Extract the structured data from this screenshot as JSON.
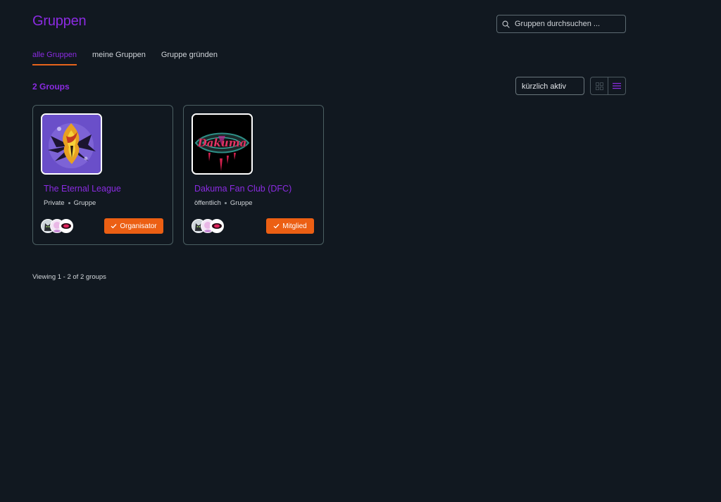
{
  "header": {
    "title": "Gruppen",
    "search_placeholder": "Gruppen durchsuchen ..."
  },
  "tabs": [
    {
      "label": "alle Gruppen",
      "active": true
    },
    {
      "label": "meine Gruppen",
      "active": false
    },
    {
      "label": "Gruppe gründen",
      "active": false
    }
  ],
  "toolbar": {
    "group_count": "2 Groups",
    "sort_selected": "kürzlich aktiv",
    "view_mode": "list"
  },
  "groups": [
    {
      "name": "The Eternal League",
      "privacy": "Private",
      "type": "Gruppe",
      "status_label": "Organisator",
      "avatar_icon": "flame-sun-emblem"
    },
    {
      "name": "Dakuma Fan Club (DFC)",
      "privacy": "öffentlich",
      "type": "Gruppe",
      "status_label": "Mitglied",
      "avatar_icon": "dakuma-eye-logo",
      "avatar_text": "Dakuma"
    }
  ],
  "pagination": "Viewing 1 - 2 of 2 groups",
  "colors": {
    "background": "#111820",
    "accent": "#8b2be2",
    "tab_underline": "#e7641b",
    "status_button": "#ec5f13",
    "card_border": "#4b5f62"
  }
}
